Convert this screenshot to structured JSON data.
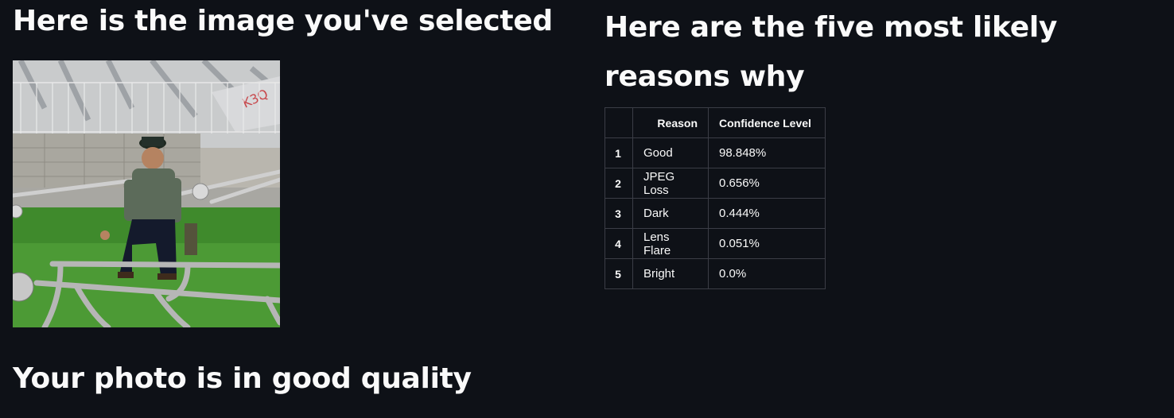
{
  "left": {
    "title": "Here is the image you've selected",
    "photo_alt": "selected photo"
  },
  "right": {
    "title": "Here are the five most likely reasons why",
    "table": {
      "headers": [
        "",
        "Reason",
        "Confidence Level"
      ],
      "rows": [
        {
          "index": "1",
          "reason": "Good",
          "confidence": "98.848%"
        },
        {
          "index": "2",
          "reason": "JPEG Loss",
          "confidence": "0.656%"
        },
        {
          "index": "3",
          "reason": "Dark",
          "confidence": "0.444%"
        },
        {
          "index": "4",
          "reason": "Lens Flare",
          "confidence": "0.051%"
        },
        {
          "index": "5",
          "reason": "Bright",
          "confidence": "0.0%"
        }
      ]
    }
  },
  "result": {
    "text": "Your photo is in good quality"
  }
}
